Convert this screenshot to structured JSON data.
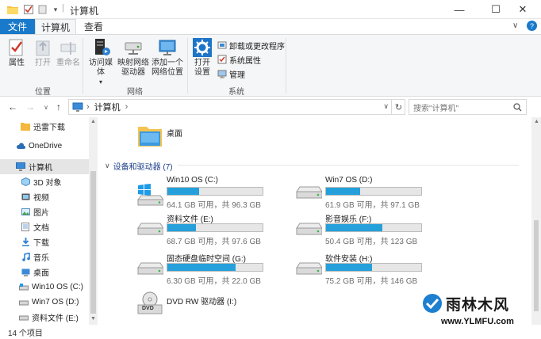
{
  "window": {
    "title": "计算机",
    "quick_access_separator": "|",
    "controls": {
      "minimize": "—",
      "maximize": "☐",
      "close": "✕"
    }
  },
  "ribbon": {
    "tabs": [
      {
        "label": "文件",
        "active": false
      },
      {
        "label": "计算机",
        "active": true
      },
      {
        "label": "查看",
        "active": false
      }
    ],
    "groups": {
      "location": {
        "label": "位置",
        "properties": "属性",
        "open": "打开",
        "rename": "重命名"
      },
      "network": {
        "label": "网络",
        "media": "访问媒体",
        "map_drive_line1": "映射网络",
        "map_drive_line2": "驱动器",
        "add_location_line1": "添加一个",
        "add_location_line2": "网络位置"
      },
      "system": {
        "label": "系统",
        "open_settings_line1": "打开",
        "open_settings_line2": "设置",
        "uninstall": "卸载或更改程序",
        "system_properties": "系统属性",
        "manage": "管理"
      }
    }
  },
  "address": {
    "path": "计算机",
    "chevron": "›",
    "search_placeholder": "搜索\"计算机\""
  },
  "sidebar": {
    "items": [
      {
        "label": "迅雷下载",
        "icon": "folder-icon"
      },
      {
        "label": "OneDrive",
        "icon": "cloud-icon"
      },
      {
        "label": "计算机",
        "icon": "computer-icon",
        "selected": true
      },
      {
        "label": "3D 对象",
        "icon": "cube-icon"
      },
      {
        "label": "视频",
        "icon": "video-icon"
      },
      {
        "label": "图片",
        "icon": "picture-icon"
      },
      {
        "label": "文档",
        "icon": "document-icon"
      },
      {
        "label": "下载",
        "icon": "download-icon"
      },
      {
        "label": "音乐",
        "icon": "music-icon"
      },
      {
        "label": "桌面",
        "icon": "desktop-icon"
      },
      {
        "label": "Win10 OS (C:)",
        "icon": "drive-icon"
      },
      {
        "label": "Win7 OS (D:)",
        "icon": "drive-icon"
      },
      {
        "label": "资料文件 (E:)",
        "icon": "drive-icon"
      }
    ]
  },
  "main": {
    "folder_desktop": "桌面",
    "section_title": "设备和驱动器 (7)",
    "drives": [
      {
        "name": "Win10 OS (C:)",
        "stat": "64.1 GB 可用，共 96.3 GB",
        "used_fraction": 0.334,
        "windows": true
      },
      {
        "name": "Win7 OS (D:)",
        "stat": "61.9 GB 可用，共 97.1 GB",
        "used_fraction": 0.362
      },
      {
        "name": "资料文件 (E:)",
        "stat": "68.7 GB 可用，共 97.6 GB",
        "used_fraction": 0.296
      },
      {
        "name": "影音娱乐 (F:)",
        "stat": "50.4 GB 可用，共 123 GB",
        "used_fraction": 0.59
      },
      {
        "name": "固态硬盘临时空间 (G:)",
        "stat": "6.30 GB 可用，共 22.0 GB",
        "used_fraction": 0.714
      },
      {
        "name": "软件安装 (H:)",
        "stat": "75.2 GB 可用，共 146 GB",
        "used_fraction": 0.485
      }
    ],
    "dvd": {
      "name": "DVD RW 驱动器 (I:)",
      "icon_text": "DVD"
    }
  },
  "status": {
    "items_count": "14 个项目"
  },
  "watermark": {
    "brand": "雨林木风",
    "url": "www.YLMFU.com"
  },
  "colors": {
    "accent": "#1979ca",
    "bar_fill": "#26a0da",
    "selected": "#e5e5e5"
  }
}
